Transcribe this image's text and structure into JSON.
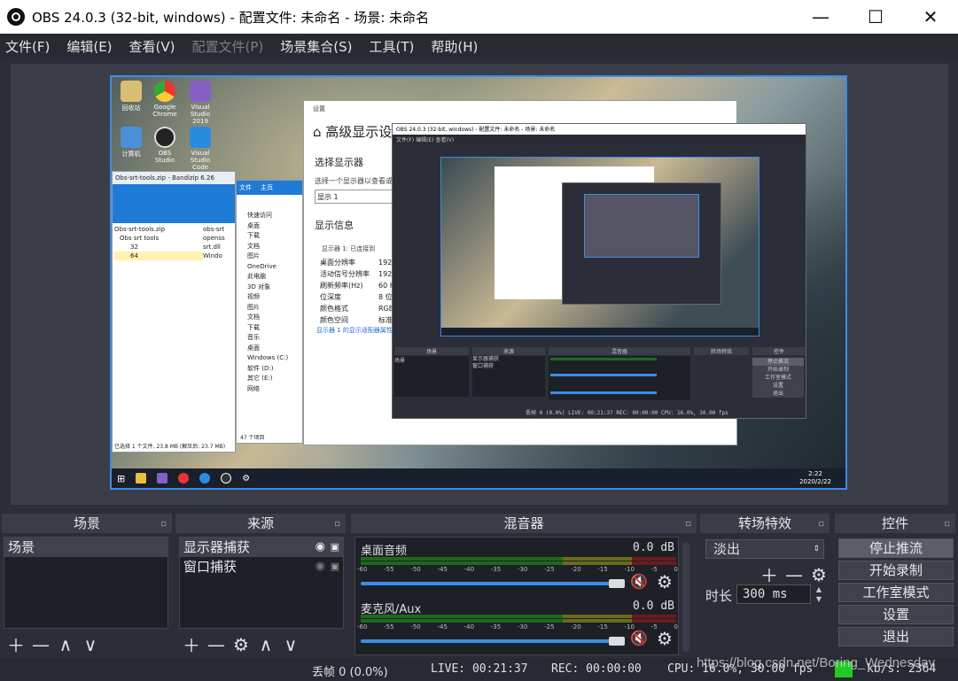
{
  "titlebar": {
    "title": "OBS 24.0.3 (32-bit, windows) - 配置文件: 未命名 - 场景: 未命名",
    "minimize": "—",
    "maximize": "☐",
    "close": "✕"
  },
  "menu": [
    "文件(F)",
    "编辑(E)",
    "查看(V)",
    "配置文件(P)",
    "场景集合(S)",
    "工具(T)",
    "帮助(H)"
  ],
  "preview": {
    "desktop_icons": [
      "回收站",
      "Google Chrome",
      "Visual Studio 2019",
      "计算机",
      "OBS Studio",
      "Visual Studio Code"
    ],
    "settings_window": {
      "header": "设置",
      "title": "高级显示设",
      "section1": "选择显示器",
      "desc": "选择一个显示器以查看或",
      "select": "显示 1",
      "section2": "显示信息",
      "monitor": "显示器 1: 已连接到",
      "rows": [
        [
          "桌面分辨率",
          "1920"
        ],
        [
          "活动信号分辨率",
          "1920"
        ],
        [
          "刷新频率(Hz)",
          "60 H"
        ],
        [
          "位深度",
          "8 位"
        ],
        [
          "颜色格式",
          "RGB"
        ],
        [
          "颜色空间",
          "标准"
        ]
      ],
      "link": "显示器 1 的显示适配器属性"
    },
    "explorer": {
      "title": "Obs-srt-tools.zip - Bandizip 6.26",
      "tree": [
        "Obs-srt-tools.zip",
        "Obs srt tools",
        "32",
        "64"
      ],
      "files": [
        "obs-srt",
        "openss",
        "srt.dll",
        "Windo"
      ],
      "status": "已选择 1 个文件, 23.8 MB (解压后: 23.7 MB)"
    },
    "explorer2": {
      "tabs": [
        "文件",
        "主页"
      ],
      "nav": [
        "快速访问",
        "桌面",
        "下载",
        "文档",
        "图片",
        "OneDrive",
        "此电脑",
        "3D 对象",
        "视频",
        "图片",
        "文档",
        "下载",
        "音乐",
        "桌面",
        "Windows (C:)",
        "软件 (D:)",
        "其它 (E:)",
        "网络"
      ],
      "status": "47 个项目"
    },
    "clock": {
      "time": "2:22",
      "date": "2020/2/22"
    }
  },
  "docks": {
    "scenes": {
      "title": "场景",
      "items": [
        "场景"
      ]
    },
    "sources": {
      "title": "来源",
      "items": [
        "显示器捕获",
        "窗口捕获"
      ]
    },
    "mixer": {
      "title": "混音器",
      "channels": [
        {
          "name": "桌面音频",
          "db": "0.0 dB"
        },
        {
          "name": "麦克风/Aux",
          "db": "0.0 dB"
        }
      ],
      "scale": [
        "-60",
        "-55",
        "-50",
        "-45",
        "-40",
        "-35",
        "-30",
        "-25",
        "-20",
        "-15",
        "-10",
        "-5",
        "0"
      ]
    },
    "transitions": {
      "title": "转场特效",
      "selected": "淡出",
      "duration_label": "时长",
      "duration": "300 ms"
    },
    "controls": {
      "title": "控件",
      "buttons": [
        "停止推流",
        "开始录制",
        "工作室模式",
        "设置",
        "退出"
      ]
    }
  },
  "tool_glyphs": {
    "add": "＋",
    "remove": "—",
    "up": "∧",
    "down": "∨",
    "gear": "⚙",
    "eye": "◉",
    "lock": "🔒",
    "mute": "🔇",
    "spin_up": "▲",
    "spin_down": "▼"
  },
  "status": {
    "dropped": "丢帧 0 (0.0%)",
    "live": "LIVE: 00:21:37",
    "rec": "REC: 00:00:00",
    "cpu": "CPU: 16.0%, 30.00 fps",
    "kbps": "kb/s: 2364",
    "watermark": "https://blog.csdn.net/Boring_Wednesday"
  },
  "colors": {
    "accent": "#3a8ee6",
    "bg": "#2b2e38",
    "green": "#22cc22",
    "mute": "#e02020"
  }
}
